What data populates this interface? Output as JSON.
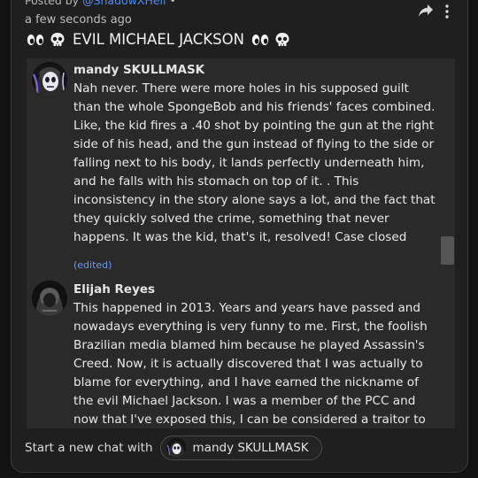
{
  "post": {
    "posted_by_prefix": "Posted by",
    "author": "@ShadowXHell",
    "dot": "•",
    "time": "a few seconds ago",
    "title": "EVIL MICHAEL JACKSON"
  },
  "thread": {
    "messages": [
      {
        "name": "mandy SKULLMASK",
        "text": "Nah never. There were more holes in his supposed guilt than the whole SpongeBob and his friends' faces combined. Like, the kid fires a .40 shot by pointing the gun at the right side of his head, and the gun instead of flying to the side or falling next to his body, it lands perfectly underneath him, and he falls with his stomach on top of it. . This inconsistency in the story alone says a lot, and the fact that they quickly solved the crime, something that never happens. It was the kid, that's it, resolved! Case closed",
        "edited": "(edited)"
      },
      {
        "name": "Elijah Reyes",
        "text": "This happened in 2013. Years and years have passed and nowadays everything is very funny to me. First, the foolish Brazilian media blamed him because he played Assassin's Creed. Now, it is actually discovered that I was actually to blame for everything, and I have earned the nickname of the evil Michael Jackson. I was a member of the PCC and now that I've exposed this, I can be considered a traitor to them."
      }
    ]
  },
  "footer": {
    "label": "Start a new chat with",
    "chip_name": "mandy SKULLMASK"
  },
  "icons": {
    "share": "share-arrow-icon",
    "more": "more-vertical-icon",
    "eyes": "eyes-emoji-icon",
    "skull": "skull-emoji-icon"
  },
  "colors": {
    "card_bg": "#1f1f1f",
    "thread_bg": "#2a2a2a",
    "link": "#4d8cf5",
    "edited": "#6f9be8"
  }
}
